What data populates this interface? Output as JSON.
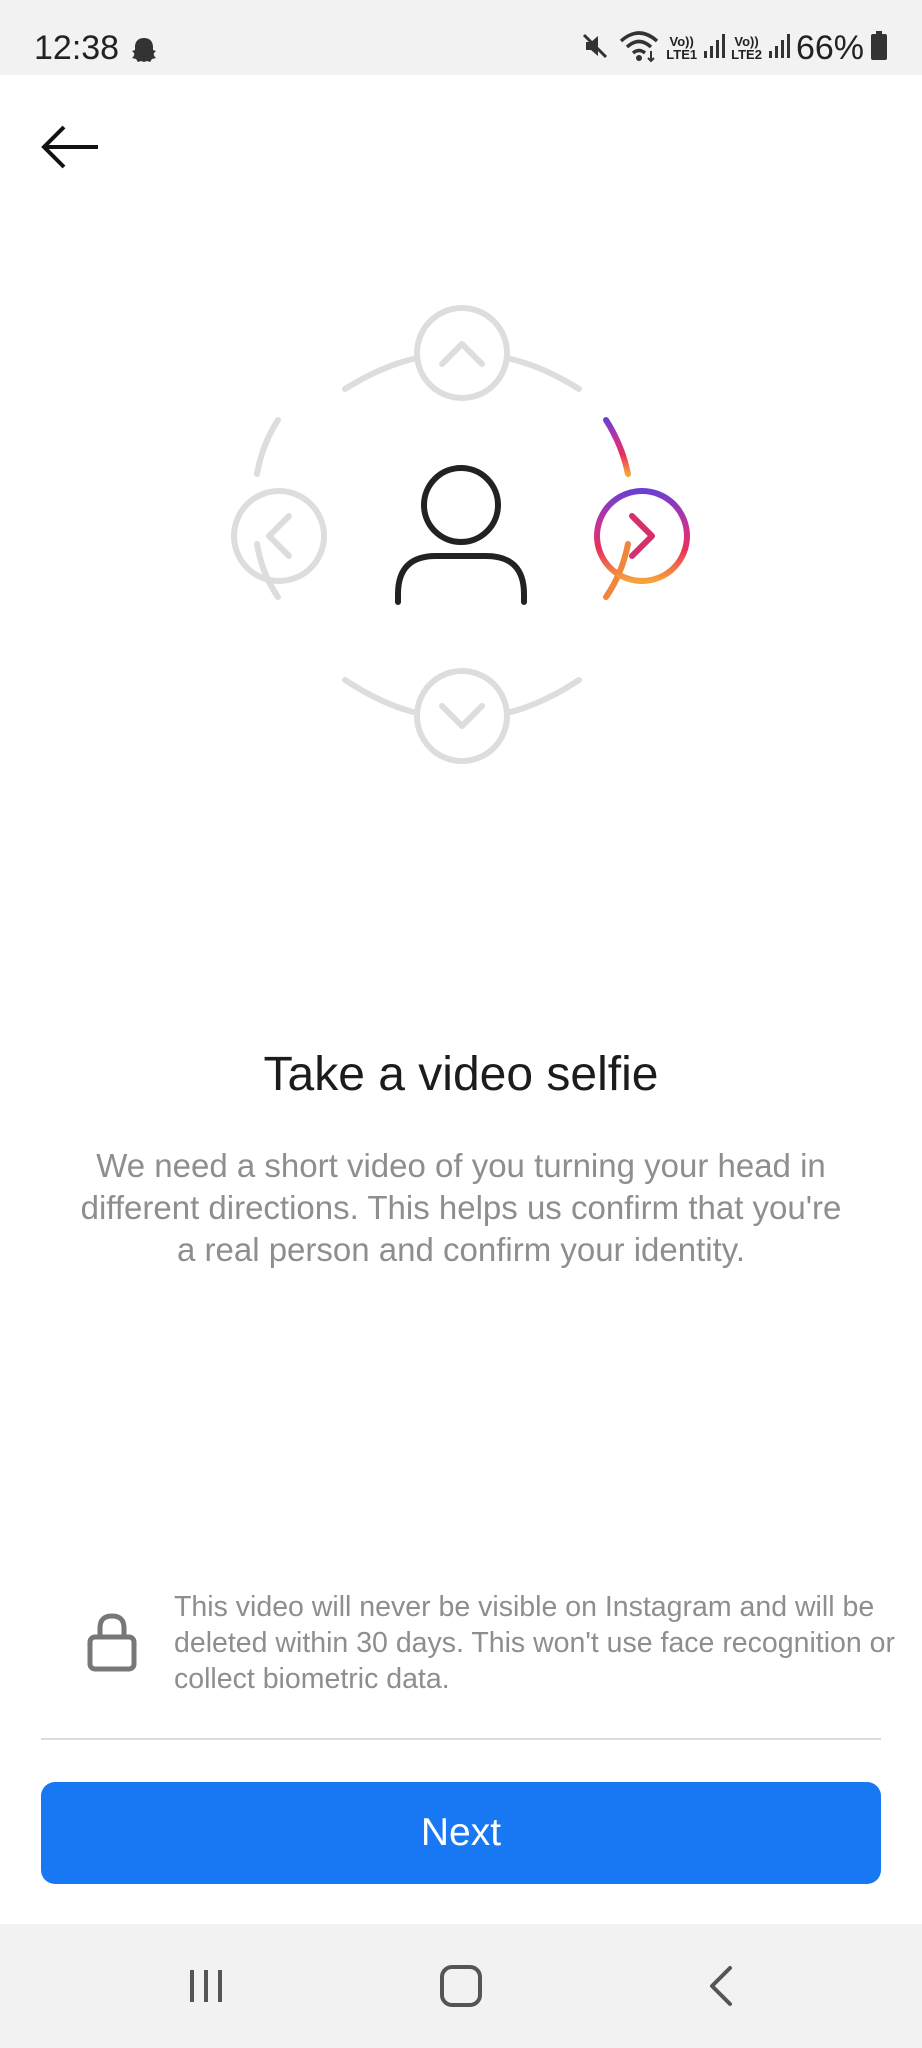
{
  "status_bar": {
    "time": "12:38",
    "battery_percent": "66%",
    "sim1_label_top": "Vo))",
    "sim1_label_bottom": "LTE1",
    "sim2_label_top": "Vo))",
    "sim2_label_bottom": "LTE2",
    "icons": [
      "snapchat-ghost-icon",
      "mute-icon",
      "wifi-icon",
      "signal-icon",
      "battery-icon"
    ]
  },
  "header": {
    "back_icon": "arrow-left-icon"
  },
  "illustration": {
    "icons": [
      "person-icon",
      "chevron-up-icon",
      "chevron-left-icon",
      "chevron-right-icon",
      "chevron-down-icon"
    ],
    "accent_gradient": [
      "#6a3fd1",
      "#c0339b",
      "#e8305a",
      "#f6a43a"
    ]
  },
  "content": {
    "title": "Take a video selfie",
    "description": "We need a short video of you turning your head in different directions. This helps us confirm that you're a real person and confirm your identity."
  },
  "privacy": {
    "icon": "lock-icon",
    "text": "This video will never be visible on Instagram and will be deleted within 30 days. This won't use face recognition or collect biometric data."
  },
  "actions": {
    "next_label": "Next",
    "button_color": "#1877f2"
  },
  "nav_bar": {
    "icons": [
      "recent-apps-icon",
      "home-icon",
      "back-icon"
    ]
  }
}
